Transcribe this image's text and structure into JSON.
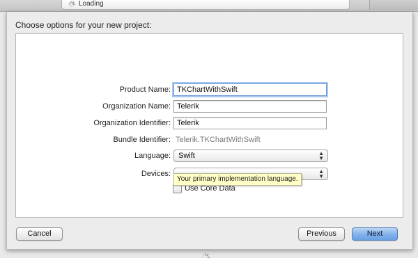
{
  "activity": {
    "status_text": "Loading",
    "icon": "spinner-icon"
  },
  "sheet": {
    "title": "Choose options for your new project:",
    "fields": {
      "product_name": {
        "label": "Product Name:",
        "value": "TKChartWithSwift"
      },
      "organization_name": {
        "label": "Organization Name:",
        "value": "Telerik"
      },
      "organization_identifier": {
        "label": "Organization Identifier:",
        "value": "Telerik"
      },
      "bundle_identifier": {
        "label": "Bundle Identifier:",
        "value": "Telerik.TKChartWithSwift"
      },
      "language": {
        "label": "Language:",
        "value": "Swift"
      },
      "devices": {
        "label": "Devices:",
        "value": ""
      }
    },
    "tooltip": "Your primary implementation language.",
    "core_data": {
      "label": "Use Core Data",
      "checked": false
    }
  },
  "buttons": {
    "cancel": "Cancel",
    "previous": "Previous",
    "next": "Next"
  },
  "colors": {
    "focus_ring": "#a7c7ef",
    "default_button": "#7fb0ea",
    "tooltip_bg": "#ffffc6"
  }
}
